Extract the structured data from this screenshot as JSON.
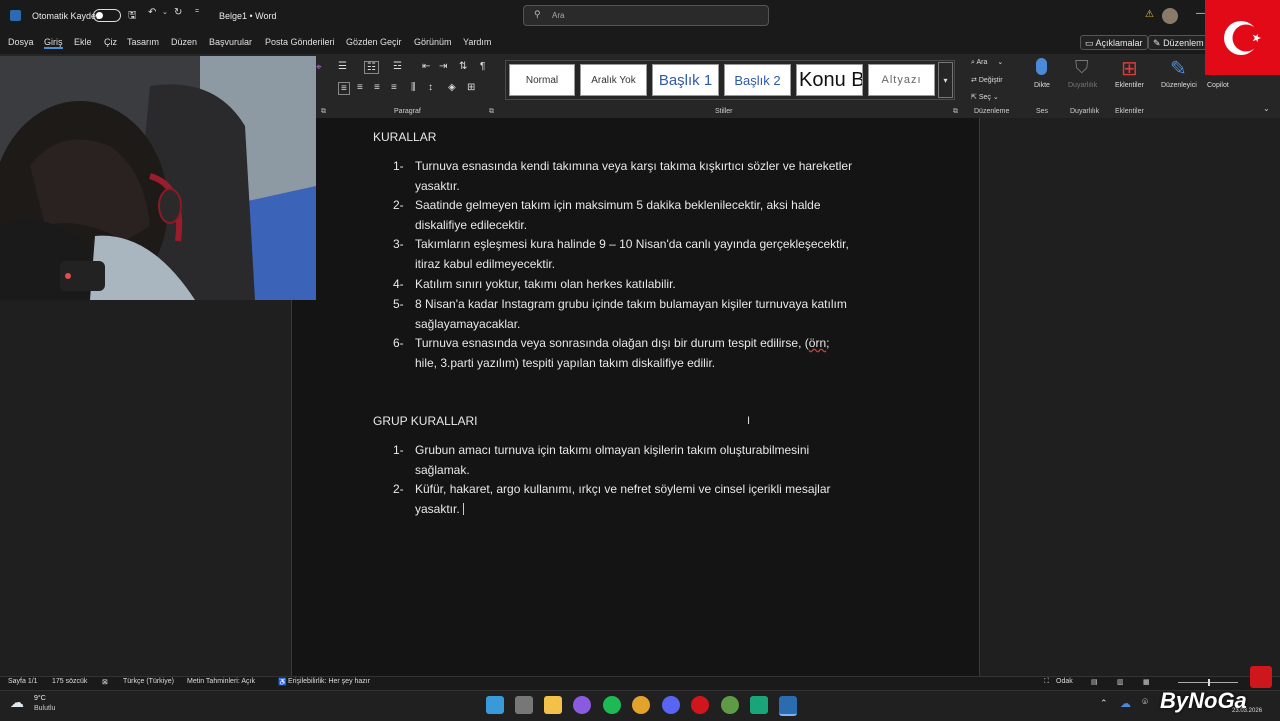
{
  "titlebar": {
    "autosave_label": "Otomatik Kaydet",
    "doc_title": "Belge1 • Word",
    "search_placeholder": "Ara"
  },
  "menu": {
    "items": [
      "Dosya",
      "Giriş",
      "Ekle",
      "Çiz",
      "Tasarım",
      "Düzen",
      "Başvurular",
      "Posta Gönderileri",
      "Gözden Geçir",
      "Görünüm",
      "Yardım"
    ],
    "comments_btn": "Açıklamalar",
    "editing_btn": "Düzenlem"
  },
  "ribbon": {
    "paragraf_label": "Paragraf",
    "stiller_label": "Stiller",
    "styles": [
      "Normal",
      "Aralık Yok",
      "Başlık 1",
      "Başlık 2",
      "Konu Başlığı",
      "Altyazı"
    ],
    "ara": "Ara",
    "degistir": "Değiştir",
    "sec": "Seç",
    "duzenleme": "Düzenleme",
    "dikte": "Dikte",
    "ses": "Ses",
    "duyarlilik": "Duyarlılık",
    "eklentiler": "Eklentiler",
    "duzenleyici": "Düzenleyici",
    "copilot": "Copilot"
  },
  "document": {
    "heading1": "KURALLAR",
    "rules": [
      {
        "num": "1-",
        "lines": [
          "Turnuva esnasında kendi takımına veya karşı takıma kışkırtıcı sözler ve hareketler",
          "yasaktır."
        ]
      },
      {
        "num": "2-",
        "lines": [
          "Saatinde gelmeyen takım için maksimum 5 dakika beklenilecektir, aksi halde",
          "diskalifiye edilecektir."
        ]
      },
      {
        "num": "3-",
        "lines": [
          "Takımların eşleşmesi kura halinde 9 – 10 Nisan'da canlı yayında gerçekleşecektir,",
          "itiraz kabul edilmeyecektir."
        ]
      },
      {
        "num": "4-",
        "lines": [
          "Katılım sınırı yoktur, takımı olan herkes katılabilir."
        ]
      },
      {
        "num": "5-",
        "lines": [
          "8 Nisan'a kadar Instagram grubu içinde takım bulamayan kişiler turnuvaya katılım",
          "sağlayamayacaklar."
        ]
      },
      {
        "num": "6-",
        "line1_pre": "Turnuva esnasında veya sonrasında olağan dışı bir durum tespit edilirse, (",
        "line1_squig": "örn",
        "line1_post": ";",
        "line2": "hile, 3.parti yazılım) tespiti yapılan takım diskalifiye edilir."
      }
    ],
    "heading2": "GRUP KURALLARI",
    "group_rules": [
      {
        "num": "1-",
        "lines": [
          "Grubun amacı turnuva için takımı olmayan kişilerin takım oluşturabilmesini",
          "sağlamak."
        ]
      },
      {
        "num": "2-",
        "lines": [
          "Küfür, hakaret, argo kullanımı, ırkçı ve nefret söylemi ve cinsel içerikli mesajlar",
          "yasaktır."
        ]
      }
    ]
  },
  "status": {
    "page": "Sayfa 1/1",
    "words": "175 sözcük",
    "language": "Türkçe (Türkiye)",
    "predictions": "Metin Tahminleri: Açık",
    "accessibility": "Erişilebilirlik: Her şey hazır",
    "focus": "Odak"
  },
  "taskbar": {
    "temp": "9°C",
    "weather": "Bulutlu",
    "date": "23.03.2026"
  },
  "overlay": {
    "brand": "ByNoGa"
  },
  "colors": {
    "word_blue": "#2b6cb0",
    "flag_red": "#e30a17"
  }
}
